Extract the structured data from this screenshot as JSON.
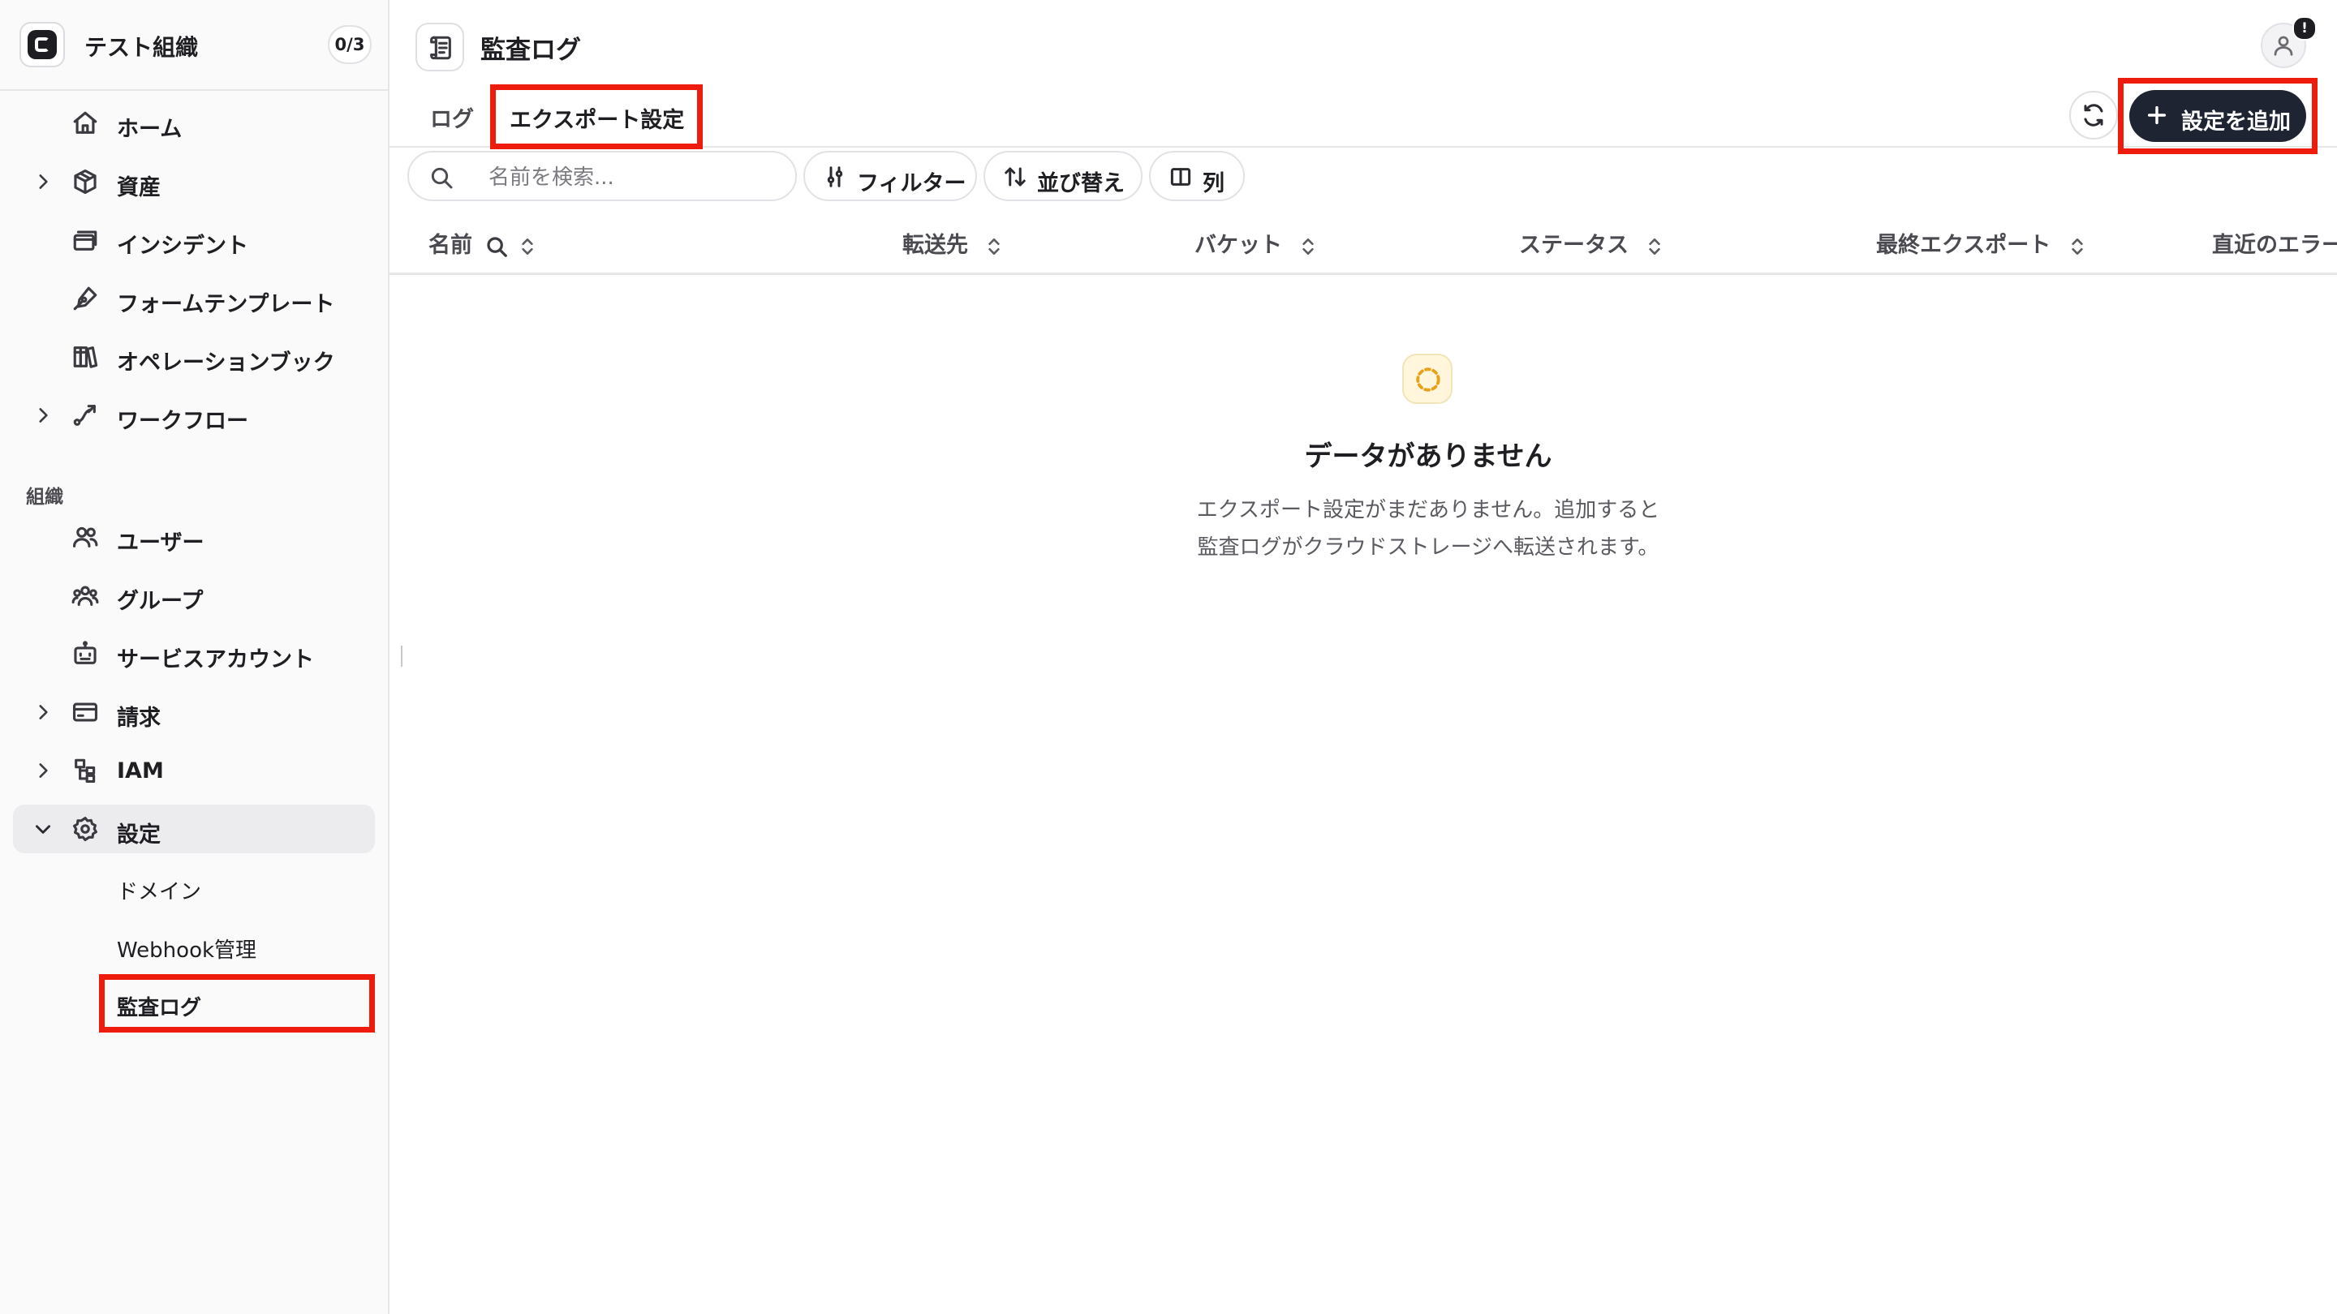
{
  "sidebar": {
    "org": {
      "name": "テスト組織",
      "count": "0/3"
    },
    "items": [
      {
        "label": "ホーム"
      },
      {
        "label": "資産"
      },
      {
        "label": "インシデント"
      },
      {
        "label": "フォームテンプレート"
      },
      {
        "label": "オペレーションブック"
      },
      {
        "label": "ワークフロー"
      }
    ],
    "section_org": "組織",
    "org_items": [
      {
        "label": "ユーザー"
      },
      {
        "label": "グループ"
      },
      {
        "label": "サービスアカウント"
      },
      {
        "label": "請求"
      },
      {
        "label": "IAM"
      },
      {
        "label": "設定"
      }
    ],
    "settings_sub": [
      {
        "label": "ドメイン"
      },
      {
        "label": "Webhook管理"
      },
      {
        "label": "監査ログ"
      }
    ]
  },
  "header": {
    "title": "監査ログ",
    "avatar_badge": "!"
  },
  "tabs": [
    {
      "label": "ログ"
    },
    {
      "label": "エクスポート設定"
    }
  ],
  "actions": {
    "add_label": "設定を追加"
  },
  "toolbar": {
    "search_placeholder": "名前を検索...",
    "filter_label": "フィルター",
    "sort_label": "並び替え",
    "columns_label": "列"
  },
  "table": {
    "columns": [
      "名前",
      "転送先",
      "バケット",
      "ステータス",
      "最終エクスポート",
      "直近のエラー"
    ]
  },
  "empty": {
    "title": "データがありません",
    "description": "エクスポート設定がまだありません。追加すると\n監査ログがクラウドストレージへ転送されます。"
  },
  "colors": {
    "accent": "#1f2433",
    "highlight": "#ee1c0c",
    "empty_icon": "#e8a21a"
  }
}
